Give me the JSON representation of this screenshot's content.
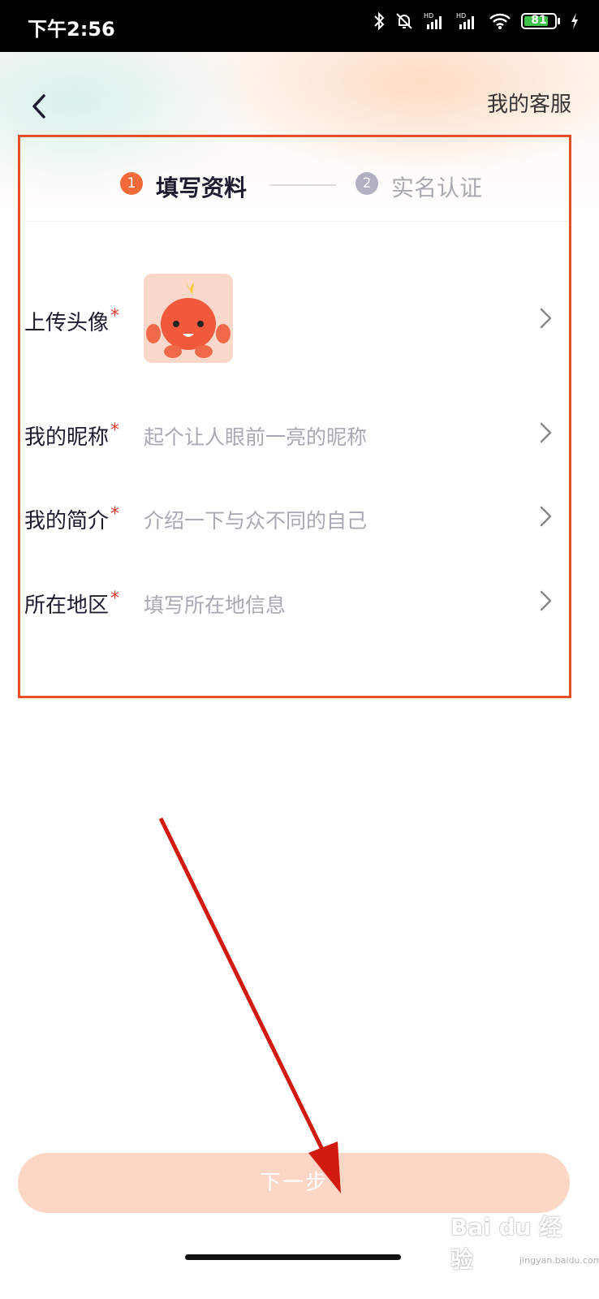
{
  "status_bar": {
    "time": "下午2:56",
    "battery_level": "81",
    "battery_fraction": 0.81,
    "icons": [
      "bluetooth-icon",
      "alarm-off-icon",
      "signal-hd-icon",
      "signal-hd-icon",
      "wifi-icon",
      "battery-icon",
      "charging-icon"
    ],
    "hd_label": "HD"
  },
  "header": {
    "back_icon": "chevron-left-icon",
    "service_label": "我的客服"
  },
  "steps": [
    {
      "number": "1",
      "label": "填写资料",
      "active": true
    },
    {
      "number": "2",
      "label": "实名认证",
      "active": false
    }
  ],
  "form": {
    "rows": [
      {
        "label": "上传头像",
        "required_mark": "*",
        "type": "avatar"
      },
      {
        "label": "我的昵称",
        "required_mark": "*",
        "placeholder": "起个让人眼前一亮的昵称"
      },
      {
        "label": "我的简介",
        "required_mark": "*",
        "placeholder": "介绍一下与众不同的自己"
      },
      {
        "label": "所在地区",
        "required_mark": "*",
        "placeholder": "填写所在地信息"
      }
    ]
  },
  "footer": {
    "next_label": "下一步"
  },
  "watermark": {
    "text": "Bai du 经验",
    "sub": "jingyan.baidu.com"
  },
  "colors": {
    "accent": "#f26a3a",
    "highlight_frame": "#e8502a",
    "arrow": "#d11b10",
    "button_disabled": "#fdd6c6",
    "required": "#e23b2f"
  }
}
